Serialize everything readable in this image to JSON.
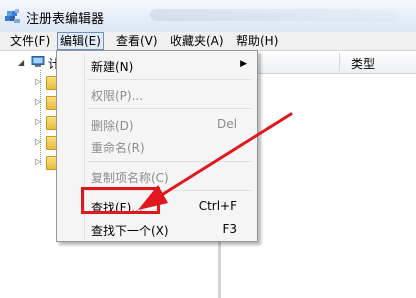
{
  "window": {
    "title": "注册表编辑器",
    "icon": "registry-editor-icon"
  },
  "menubar": {
    "items": [
      {
        "label": "文件(F)"
      },
      {
        "label": "编辑(E)"
      },
      {
        "label": "查看(V)"
      },
      {
        "label": "收藏夹(A)"
      },
      {
        "label": "帮助(H)"
      }
    ],
    "active_index": 1
  },
  "tree": {
    "root_label": "计",
    "root_icon": "computer-icon",
    "child_icon": "folder-icon"
  },
  "list": {
    "columns": [
      {
        "label": "类型"
      }
    ]
  },
  "edit_menu": {
    "items": [
      {
        "label": "新建(N)",
        "shortcut": "",
        "has_submenu": true,
        "enabled": true
      },
      {
        "label": "权限(P)...",
        "shortcut": "",
        "has_submenu": false,
        "enabled": false
      },
      {
        "label": "删除(D)",
        "shortcut": "Del",
        "has_submenu": false,
        "enabled": false
      },
      {
        "label": "重命名(R)",
        "shortcut": "",
        "has_submenu": false,
        "enabled": false
      },
      {
        "label": "复制项名称(C)",
        "shortcut": "",
        "has_submenu": false,
        "enabled": false
      },
      {
        "label": "查找(F)...",
        "shortcut": "Ctrl+F",
        "has_submenu": false,
        "enabled": true
      },
      {
        "label": "查找下一个(X)",
        "shortcut": "F3",
        "has_submenu": false,
        "enabled": true
      }
    ]
  },
  "annotation": {
    "highlighted_item": "查找(F)...",
    "color": "#e0171d"
  }
}
